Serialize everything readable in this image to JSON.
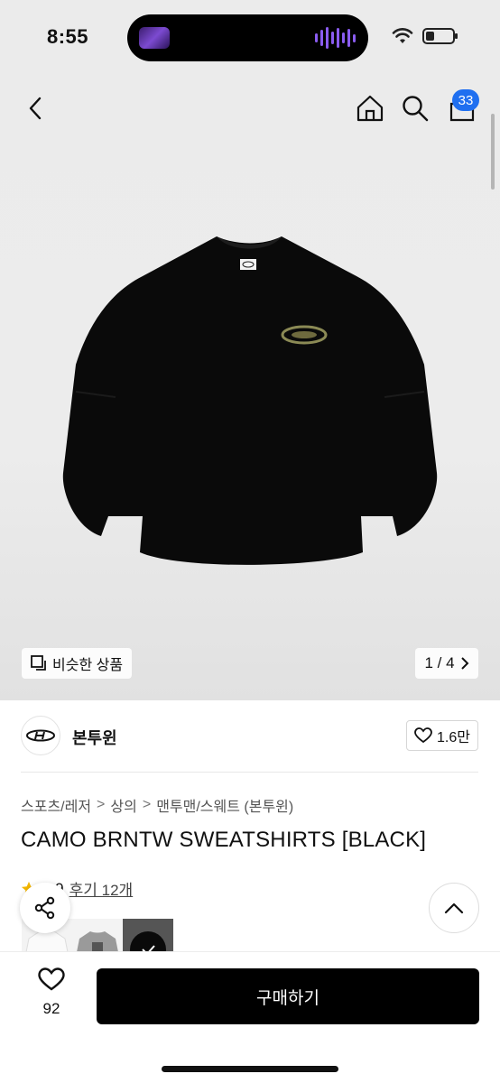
{
  "status_bar": {
    "time": "8:55"
  },
  "header": {
    "cart_count": "33"
  },
  "gallery": {
    "similar_label": "비슷한 상품",
    "pager": "1 / 4"
  },
  "brand": {
    "name": "본투윈",
    "likes": "1.6만"
  },
  "breadcrumb": [
    "스포츠/레저",
    "상의",
    "맨투맨/스웨트 (본투윈)"
  ],
  "product": {
    "title": "CAMO BRNTW SWEATSHIRTS [BLACK]",
    "rating": "4.9",
    "reviews": "후기 12개"
  },
  "bottom": {
    "favorite_count": "92",
    "buy_label": "구매하기"
  },
  "colors": {
    "accent": "#1f6ff0",
    "buy_bg": "#000000"
  }
}
